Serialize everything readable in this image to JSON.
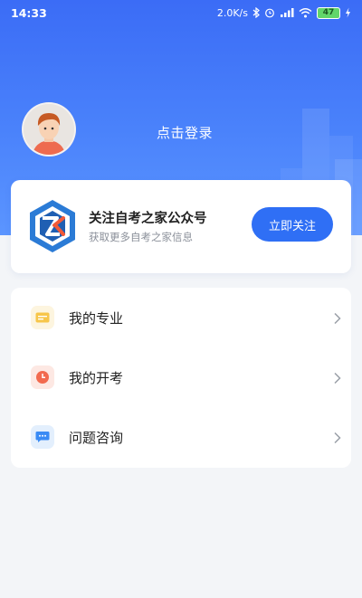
{
  "status_bar": {
    "time": "14:33",
    "net_speed": "2.0K/s",
    "signal": "4G",
    "battery": "47",
    "icons": [
      "bluetooth-icon",
      "alarm-icon",
      "signal-icon",
      "wifi-icon",
      "battery-icon",
      "charging-icon"
    ]
  },
  "profile": {
    "avatar_icon": "user-avatar",
    "login_label": "点击登录"
  },
  "promo": {
    "logo_icon": "zk-logo",
    "title": "关注自考之家公众号",
    "subtitle": "获取更多自考之家信息",
    "button_label": "立即关注"
  },
  "menu": {
    "items": [
      {
        "label": "我的专业",
        "icon": "major-icon",
        "icon_color": "#f7c64a",
        "icon_bg": "#fdf5df"
      },
      {
        "label": "我的开考",
        "icon": "clock-icon",
        "icon_color": "#f26a4f",
        "icon_bg": "#fde8e3"
      },
      {
        "label": "问题咨询",
        "icon": "chat-icon",
        "icon_color": "#3a8bf5",
        "icon_bg": "#e3effd"
      }
    ]
  },
  "colors": {
    "header": "#3b6cf6",
    "accent": "#2f6ff5",
    "background": "#f3f5f8"
  }
}
